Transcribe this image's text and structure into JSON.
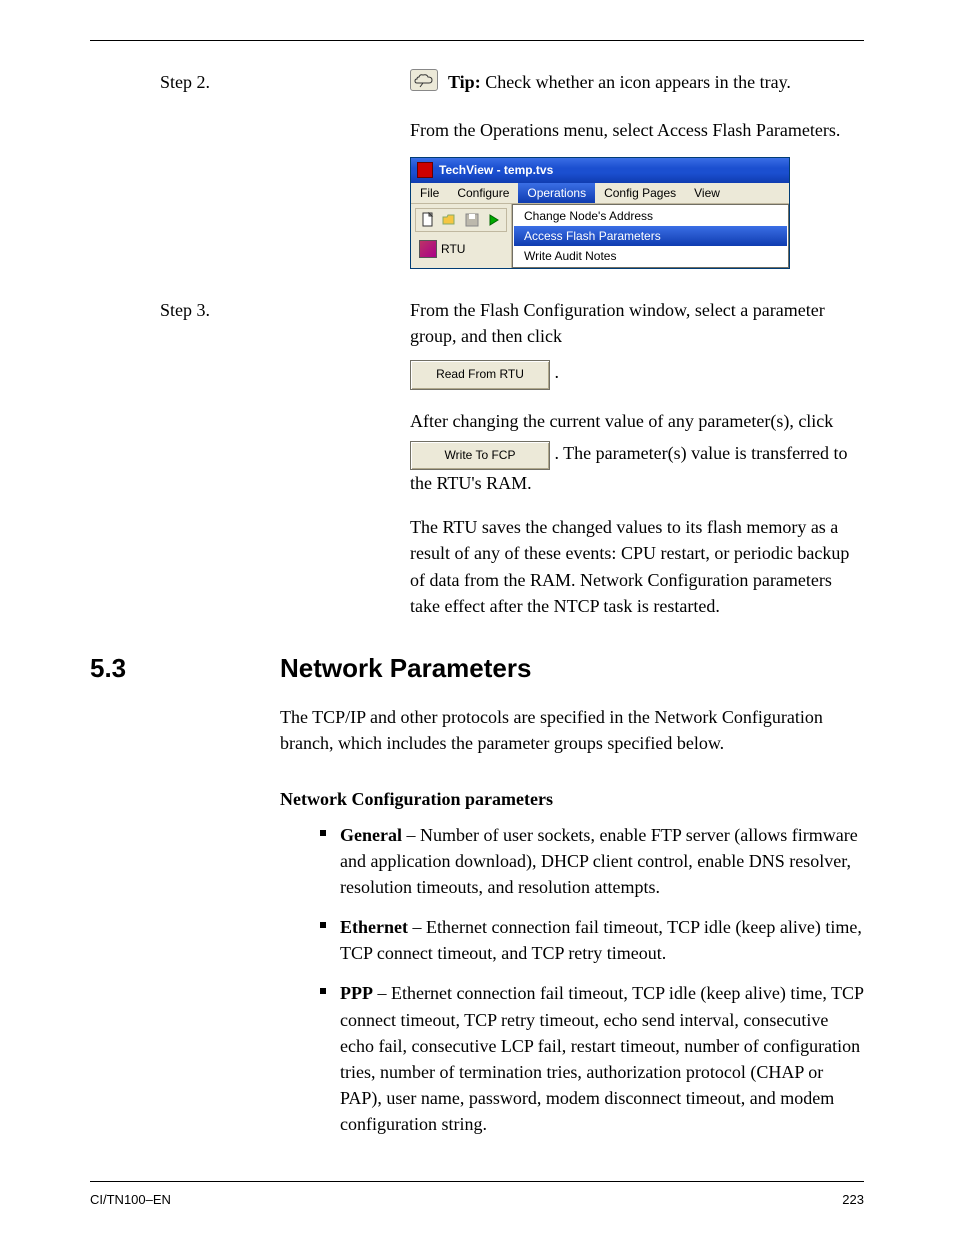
{
  "step2": {
    "label": "Step 2.",
    "tip_prefix": "Tip:",
    "tip_text": " Check whether an icon appears in the tray."
  },
  "step2b": "From the Operations menu, select Access Flash Parameters.",
  "tv": {
    "title": "TechView - temp.tvs",
    "menus": [
      "File",
      "Configure",
      "Operations",
      "Config Pages",
      "View"
    ],
    "selected_menu": "Operations",
    "dropdown": [
      "Change Node's Address",
      "Access Flash Parameters",
      "Write Audit Notes"
    ],
    "selected_item": "Access Flash Parameters",
    "rtu_label": "RTU"
  },
  "step3": {
    "label": "Step 3.",
    "text_a": "From the Flash Configuration window, select a parameter group, and then click",
    "button1": "Read From RTU",
    "text_b": ".",
    "text_c": "After changing the current value of any parameter(s), click ",
    "button2": "Write To FCP",
    "text_d": ". The parameter(s) value is transferred to the RTU's RAM.",
    "text_e": "The RTU saves the changed values to its flash memory as a result of any of these events: CPU restart, or periodic backup of data from the RAM. Network Configuration parameters take effect after the NTCP task is restarted."
  },
  "section": {
    "num": "5.3",
    "title": "Network Parameters"
  },
  "net_text": "The TCP/IP and other protocols are specified in the Network Configuration branch, which includes the parameter groups specified below.",
  "net_subhead": "Network Configuration parameters",
  "bullets": [
    {
      "head": "General",
      "body": " – Number of user sockets, enable FTP server (allows firmware and application download), DHCP client control, enable DNS resolver, resolution timeouts, and resolution attempts."
    },
    {
      "head": "Ethernet",
      "body": " – Ethernet connection fail timeout, TCP idle (keep alive) time, TCP connect timeout, and TCP retry timeout."
    },
    {
      "head": "PPP",
      "body": " – Ethernet connection fail timeout, TCP idle (keep alive) time, TCP connect timeout, TCP retry timeout, echo send interval, consecutive echo fail, consecutive LCP fail, restart timeout, number of configuration tries, number of termination tries, authorization protocol (CHAP or PAP), user name, password, modem disconnect timeout, and modem configuration string."
    }
  ],
  "footer": {
    "left": "CI/TN100–EN",
    "right": "223"
  }
}
